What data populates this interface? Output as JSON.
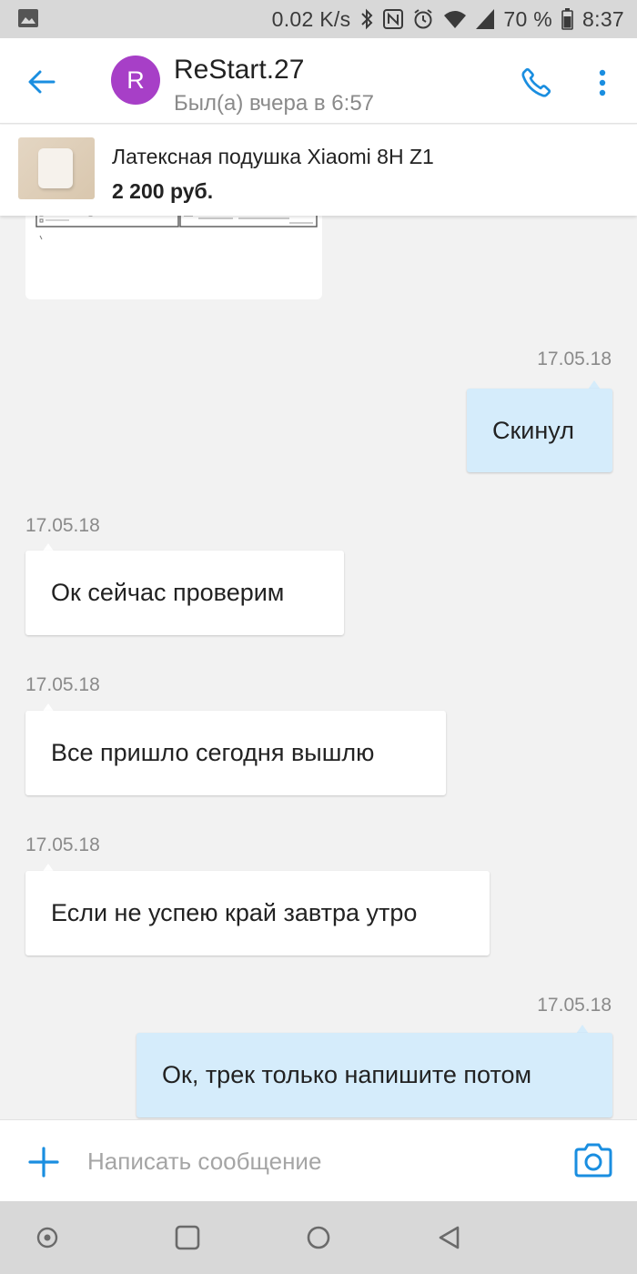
{
  "status_bar": {
    "net_speed": "0.02 K/s",
    "battery": "70 %",
    "time": "8:37",
    "icons": [
      "image-icon",
      "bluetooth-icon",
      "nfc-icon",
      "alarm-icon",
      "wifi-icon",
      "signal-icon",
      "battery-icon"
    ]
  },
  "header": {
    "avatar_letter": "R",
    "avatar_color": "#a73fc7",
    "contact_name": "ReStart.27",
    "contact_status": "Был(а) вчера в 6:57",
    "accent_color": "#1a8ee0"
  },
  "product": {
    "title": "Латексная подушка Xiaomi 8H Z1",
    "price": "2 200 руб."
  },
  "messages": [
    {
      "direction": "out",
      "timestamp": "17.05.18",
      "text": "Скинул"
    },
    {
      "direction": "in",
      "timestamp": "17.05.18",
      "text": "Ок сейчас проверим"
    },
    {
      "direction": "in",
      "timestamp": "17.05.18",
      "text": "Все пришло сегодня вышлю"
    },
    {
      "direction": "in",
      "timestamp": "17.05.18",
      "text": "Если не успею край завтра утро"
    },
    {
      "direction": "out",
      "timestamp": "17.05.18",
      "text": "Ок, трек только напишите потом"
    }
  ],
  "input": {
    "placeholder": "Написать сообщение",
    "value": ""
  },
  "nav": {
    "buttons": [
      "assistant-icon",
      "recents-icon",
      "home-icon",
      "back-triangle-icon"
    ]
  }
}
